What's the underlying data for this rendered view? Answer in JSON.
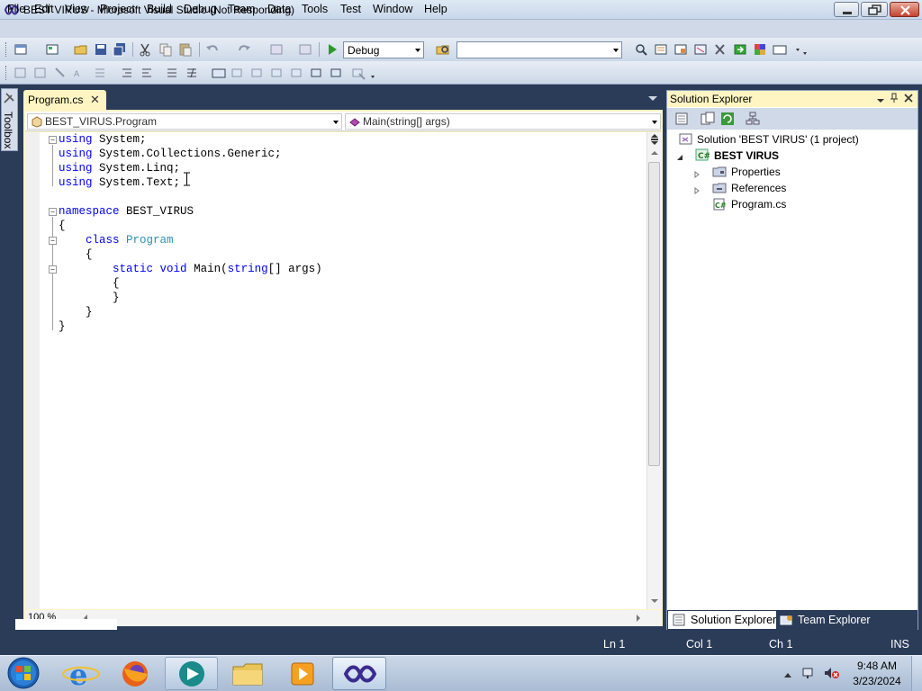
{
  "window": {
    "title": "BEST VIRUS - Microsoft Visual Studio (Not Responding)"
  },
  "menu": [
    "File",
    "Edit",
    "View",
    "Project",
    "Build",
    "Debug",
    "Team",
    "Data",
    "Tools",
    "Test",
    "Window",
    "Help"
  ],
  "toolbar": {
    "configuration": "Debug",
    "platform": ""
  },
  "toolbox": {
    "label": "Toolbox"
  },
  "document": {
    "tab_label": "Program.cs",
    "type_combo": "BEST_VIRUS.Program",
    "member_combo": "Main(string[] args)",
    "zoom": "100 %"
  },
  "code": {
    "lines": [
      [
        "kw:using",
        " System;"
      ],
      [
        "kw:using",
        " System.Collections.Generic;"
      ],
      [
        "kw:using",
        " System.Linq;"
      ],
      [
        "kw:using",
        " System.Text;"
      ],
      [
        ""
      ],
      [
        "kw:namespace",
        " BEST_VIRUS"
      ],
      [
        "{"
      ],
      [
        "    ",
        "kw:class",
        " ",
        "ty:Program"
      ],
      [
        "    {"
      ],
      [
        "        ",
        "kw:static",
        " ",
        "kw:void",
        " Main(",
        "kw:string",
        "[] args)"
      ],
      [
        "        {"
      ],
      [
        "        }"
      ],
      [
        "    }"
      ],
      [
        "}"
      ]
    ]
  },
  "solution_explorer": {
    "title": "Solution Explorer",
    "solution": "Solution 'BEST VIRUS' (1 project)",
    "project": "BEST VIRUS",
    "items": [
      "Properties",
      "References",
      "Program.cs"
    ],
    "tabs": [
      "Solution Explorer",
      "Team Explorer"
    ]
  },
  "status": {
    "ln": "Ln 1",
    "col": "Col 1",
    "ch": "Ch 1",
    "mode": "INS"
  },
  "taskbar": {
    "time": "9:48 AM",
    "date": "3/23/2024",
    "apps": [
      "start-orb-icon",
      "internet-explorer-icon",
      "firefox-icon",
      "quick-media-icon",
      "file-explorer-icon",
      "media-player-icon",
      "visual-studio-icon"
    ]
  }
}
